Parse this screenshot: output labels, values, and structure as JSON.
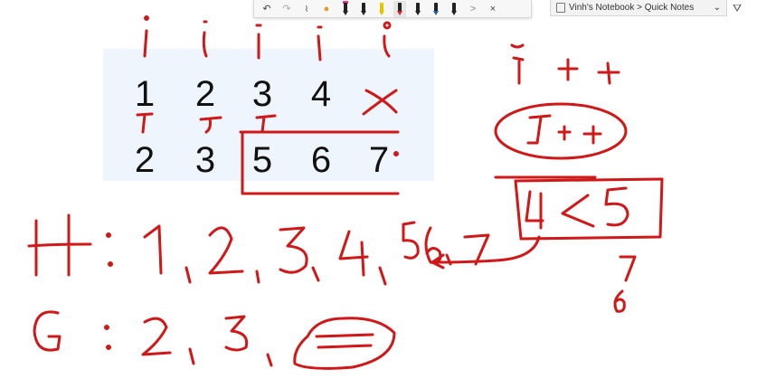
{
  "toolbar": {
    "undo_icon": "undo-icon",
    "redo_icon": "redo-icon",
    "lasso_icon": "lasso-select-icon",
    "pen_colors": [
      "#e8398a",
      "#222222",
      "#e6c200",
      "#e02020",
      "#222222",
      "#1d5fa8",
      "#222222"
    ],
    "more_label": ">",
    "close_label": "×"
  },
  "breadcrumb": {
    "text": "Vinh's Notebook > Quick Notes",
    "chevron": "⌄"
  },
  "board": {
    "row1": [
      "1",
      "2",
      "3",
      "4"
    ],
    "row2": [
      "2",
      "3",
      "5",
      "6",
      "7"
    ]
  },
  "colors": {
    "ink": "#d01818",
    "card": "#eef5fc"
  }
}
